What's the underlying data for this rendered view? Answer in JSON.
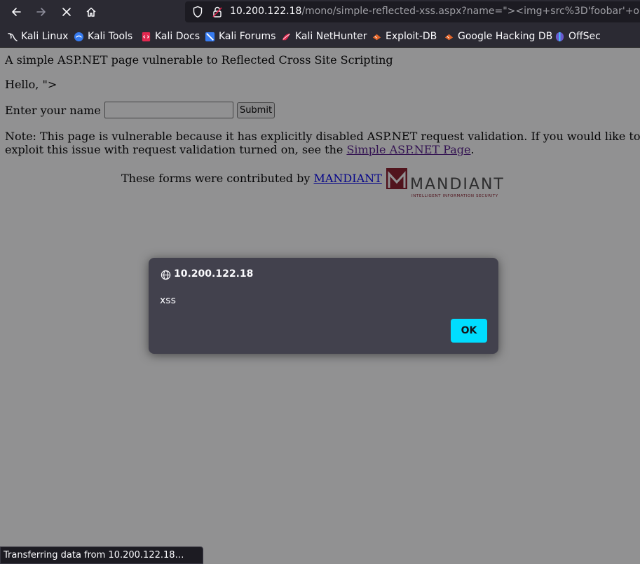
{
  "toolbar": {
    "back_icon": "arrow-left-icon",
    "forward_icon": "arrow-right-icon",
    "stop_icon": "close-icon",
    "home_icon": "home-icon",
    "url_host": "10.200.122.18",
    "url_path": "/mono/simple-reflected-xss.aspx?name=\"><img+src%3D'foobar'+onerr"
  },
  "bookmarks": [
    {
      "label": "Kali Linux",
      "icon": "kali-dragon-icon"
    },
    {
      "label": "Kali Tools",
      "icon": "kali-tools-icon"
    },
    {
      "label": "Kali Docs",
      "icon": "kali-docs-icon"
    },
    {
      "label": "Kali Forums",
      "icon": "kali-forums-icon"
    },
    {
      "label": "Kali NetHunter",
      "icon": "nethunter-icon"
    },
    {
      "label": "Exploit-DB",
      "icon": "exploit-db-icon"
    },
    {
      "label": "Google Hacking DB",
      "icon": "ghdb-icon"
    },
    {
      "label": "OffSec",
      "icon": "offsec-icon"
    }
  ],
  "page": {
    "heading": "A simple ASP.NET page vulnerable to Reflected Cross Site Scripting",
    "hello": "Hello, \">",
    "name_label": "Enter your name",
    "name_value": "",
    "submit_label": "Submit",
    "note_before": "Note: This page is vulnerable because it has explicitly disabled ASP.NET request validation. If you would like to try to exploit this issue with request validation turned on, see the ",
    "note_link": "Simple ASP.NET Page",
    "note_after": ".",
    "contrib_text": "These forms were contributed by ",
    "contrib_link": "MANDIANT",
    "logo_text": "MANDIANT",
    "logo_tagline": "INTELLIGENT INFORMATION SECURITY"
  },
  "dialog": {
    "icon": "globe-icon",
    "title": "10.200.122.18",
    "message": "xss",
    "ok_label": "OK"
  },
  "status": "Transferring data from 10.200.122.18…",
  "colors": {
    "chrome_bg": "#2b2a33",
    "dialog_bg": "#42414d",
    "ok_button": "#00ddff",
    "link": "#0000ee",
    "visited_link": "#551a8b"
  }
}
